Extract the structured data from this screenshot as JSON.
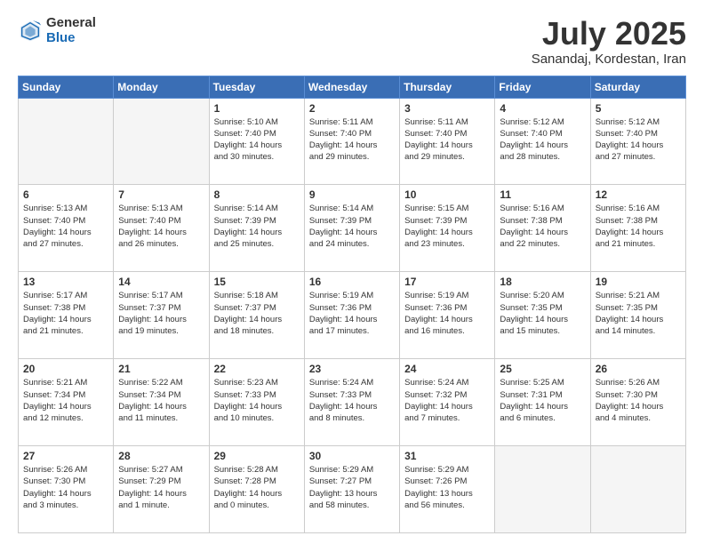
{
  "header": {
    "logo_general": "General",
    "logo_blue": "Blue",
    "month_title": "July 2025",
    "subtitle": "Sanandaj, Kordestan, Iran"
  },
  "weekdays": [
    "Sunday",
    "Monday",
    "Tuesday",
    "Wednesday",
    "Thursday",
    "Friday",
    "Saturday"
  ],
  "weeks": [
    [
      {
        "day": "",
        "info": ""
      },
      {
        "day": "",
        "info": ""
      },
      {
        "day": "1",
        "info": "Sunrise: 5:10 AM\nSunset: 7:40 PM\nDaylight: 14 hours\nand 30 minutes."
      },
      {
        "day": "2",
        "info": "Sunrise: 5:11 AM\nSunset: 7:40 PM\nDaylight: 14 hours\nand 29 minutes."
      },
      {
        "day": "3",
        "info": "Sunrise: 5:11 AM\nSunset: 7:40 PM\nDaylight: 14 hours\nand 29 minutes."
      },
      {
        "day": "4",
        "info": "Sunrise: 5:12 AM\nSunset: 7:40 PM\nDaylight: 14 hours\nand 28 minutes."
      },
      {
        "day": "5",
        "info": "Sunrise: 5:12 AM\nSunset: 7:40 PM\nDaylight: 14 hours\nand 27 minutes."
      }
    ],
    [
      {
        "day": "6",
        "info": "Sunrise: 5:13 AM\nSunset: 7:40 PM\nDaylight: 14 hours\nand 27 minutes."
      },
      {
        "day": "7",
        "info": "Sunrise: 5:13 AM\nSunset: 7:40 PM\nDaylight: 14 hours\nand 26 minutes."
      },
      {
        "day": "8",
        "info": "Sunrise: 5:14 AM\nSunset: 7:39 PM\nDaylight: 14 hours\nand 25 minutes."
      },
      {
        "day": "9",
        "info": "Sunrise: 5:14 AM\nSunset: 7:39 PM\nDaylight: 14 hours\nand 24 minutes."
      },
      {
        "day": "10",
        "info": "Sunrise: 5:15 AM\nSunset: 7:39 PM\nDaylight: 14 hours\nand 23 minutes."
      },
      {
        "day": "11",
        "info": "Sunrise: 5:16 AM\nSunset: 7:38 PM\nDaylight: 14 hours\nand 22 minutes."
      },
      {
        "day": "12",
        "info": "Sunrise: 5:16 AM\nSunset: 7:38 PM\nDaylight: 14 hours\nand 21 minutes."
      }
    ],
    [
      {
        "day": "13",
        "info": "Sunrise: 5:17 AM\nSunset: 7:38 PM\nDaylight: 14 hours\nand 21 minutes."
      },
      {
        "day": "14",
        "info": "Sunrise: 5:17 AM\nSunset: 7:37 PM\nDaylight: 14 hours\nand 19 minutes."
      },
      {
        "day": "15",
        "info": "Sunrise: 5:18 AM\nSunset: 7:37 PM\nDaylight: 14 hours\nand 18 minutes."
      },
      {
        "day": "16",
        "info": "Sunrise: 5:19 AM\nSunset: 7:36 PM\nDaylight: 14 hours\nand 17 minutes."
      },
      {
        "day": "17",
        "info": "Sunrise: 5:19 AM\nSunset: 7:36 PM\nDaylight: 14 hours\nand 16 minutes."
      },
      {
        "day": "18",
        "info": "Sunrise: 5:20 AM\nSunset: 7:35 PM\nDaylight: 14 hours\nand 15 minutes."
      },
      {
        "day": "19",
        "info": "Sunrise: 5:21 AM\nSunset: 7:35 PM\nDaylight: 14 hours\nand 14 minutes."
      }
    ],
    [
      {
        "day": "20",
        "info": "Sunrise: 5:21 AM\nSunset: 7:34 PM\nDaylight: 14 hours\nand 12 minutes."
      },
      {
        "day": "21",
        "info": "Sunrise: 5:22 AM\nSunset: 7:34 PM\nDaylight: 14 hours\nand 11 minutes."
      },
      {
        "day": "22",
        "info": "Sunrise: 5:23 AM\nSunset: 7:33 PM\nDaylight: 14 hours\nand 10 minutes."
      },
      {
        "day": "23",
        "info": "Sunrise: 5:24 AM\nSunset: 7:33 PM\nDaylight: 14 hours\nand 8 minutes."
      },
      {
        "day": "24",
        "info": "Sunrise: 5:24 AM\nSunset: 7:32 PM\nDaylight: 14 hours\nand 7 minutes."
      },
      {
        "day": "25",
        "info": "Sunrise: 5:25 AM\nSunset: 7:31 PM\nDaylight: 14 hours\nand 6 minutes."
      },
      {
        "day": "26",
        "info": "Sunrise: 5:26 AM\nSunset: 7:30 PM\nDaylight: 14 hours\nand 4 minutes."
      }
    ],
    [
      {
        "day": "27",
        "info": "Sunrise: 5:26 AM\nSunset: 7:30 PM\nDaylight: 14 hours\nand 3 minutes."
      },
      {
        "day": "28",
        "info": "Sunrise: 5:27 AM\nSunset: 7:29 PM\nDaylight: 14 hours\nand 1 minute."
      },
      {
        "day": "29",
        "info": "Sunrise: 5:28 AM\nSunset: 7:28 PM\nDaylight: 14 hours\nand 0 minutes."
      },
      {
        "day": "30",
        "info": "Sunrise: 5:29 AM\nSunset: 7:27 PM\nDaylight: 13 hours\nand 58 minutes."
      },
      {
        "day": "31",
        "info": "Sunrise: 5:29 AM\nSunset: 7:26 PM\nDaylight: 13 hours\nand 56 minutes."
      },
      {
        "day": "",
        "info": ""
      },
      {
        "day": "",
        "info": ""
      }
    ]
  ]
}
